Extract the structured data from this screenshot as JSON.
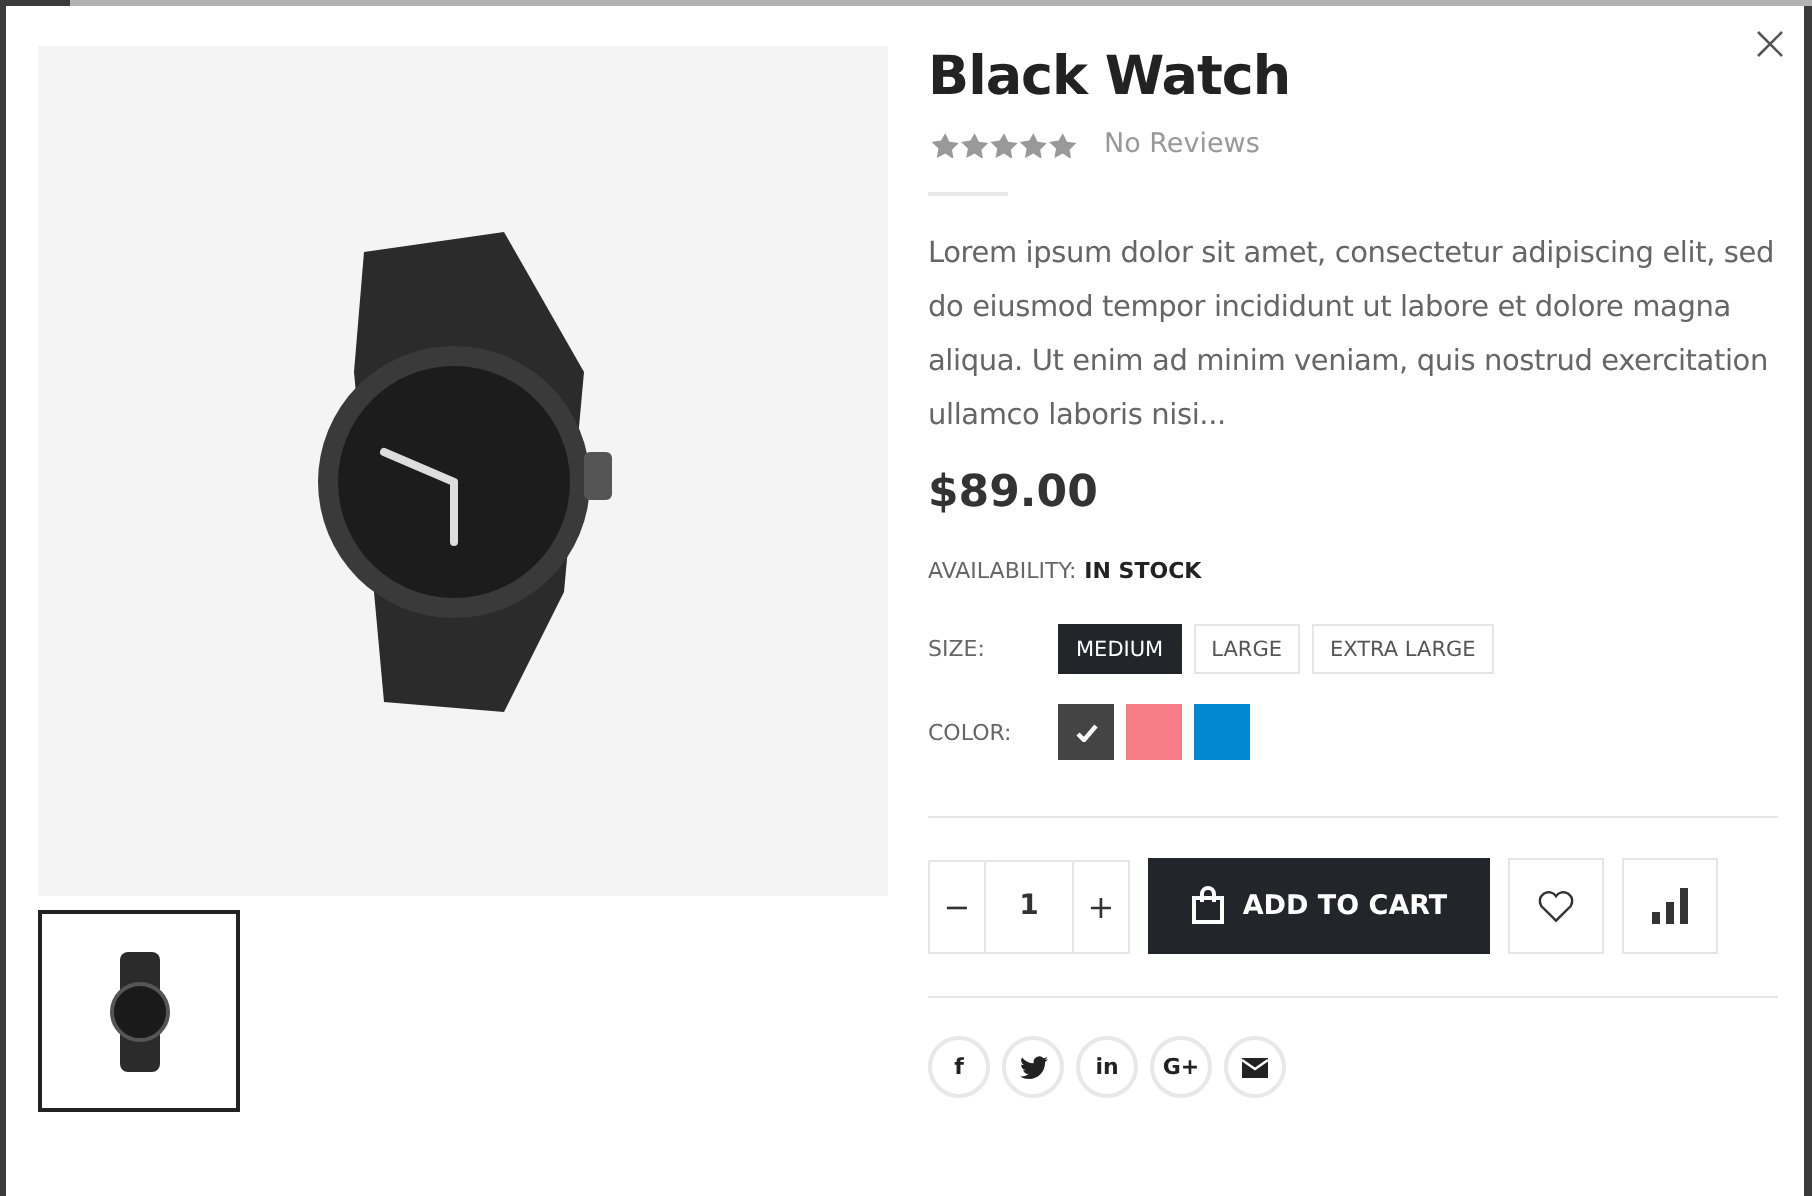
{
  "product": {
    "title": "Black Watch",
    "reviews": "No Reviews",
    "description": "Lorem ipsum dolor sit amet, consectetur adipiscing elit, sed do eiusmod tempor incididunt ut labore et dolore magna aliqua. Ut enim ad minim veniam, quis nostrud exercitation ullamco laboris nisi...",
    "price": "$89.00"
  },
  "availability": {
    "label": "AVAILABILITY:",
    "value": "IN STOCK"
  },
  "size": {
    "label": "SIZE:",
    "options": [
      {
        "label": "MEDIUM",
        "selected": true
      },
      {
        "label": "LARGE",
        "selected": false
      },
      {
        "label": "EXTRA LARGE",
        "selected": false
      }
    ]
  },
  "color": {
    "label": "COLOR:",
    "options": [
      {
        "color": "#444444",
        "selected": true
      },
      {
        "color": "#f77d87",
        "selected": false
      },
      {
        "color": "#0288d1",
        "selected": false
      }
    ]
  },
  "quantity": {
    "minus": "−",
    "value": "1",
    "plus": "+"
  },
  "add_to_cart": "ADD TO CART",
  "thumbnails": [
    {
      "selected": true
    }
  ],
  "socials": [
    {
      "kind": "glyph",
      "label": "f"
    },
    {
      "kind": "bird"
    },
    {
      "kind": "glyph",
      "label": "in"
    },
    {
      "kind": "glyph",
      "label": "G+"
    },
    {
      "kind": "envelope"
    }
  ]
}
